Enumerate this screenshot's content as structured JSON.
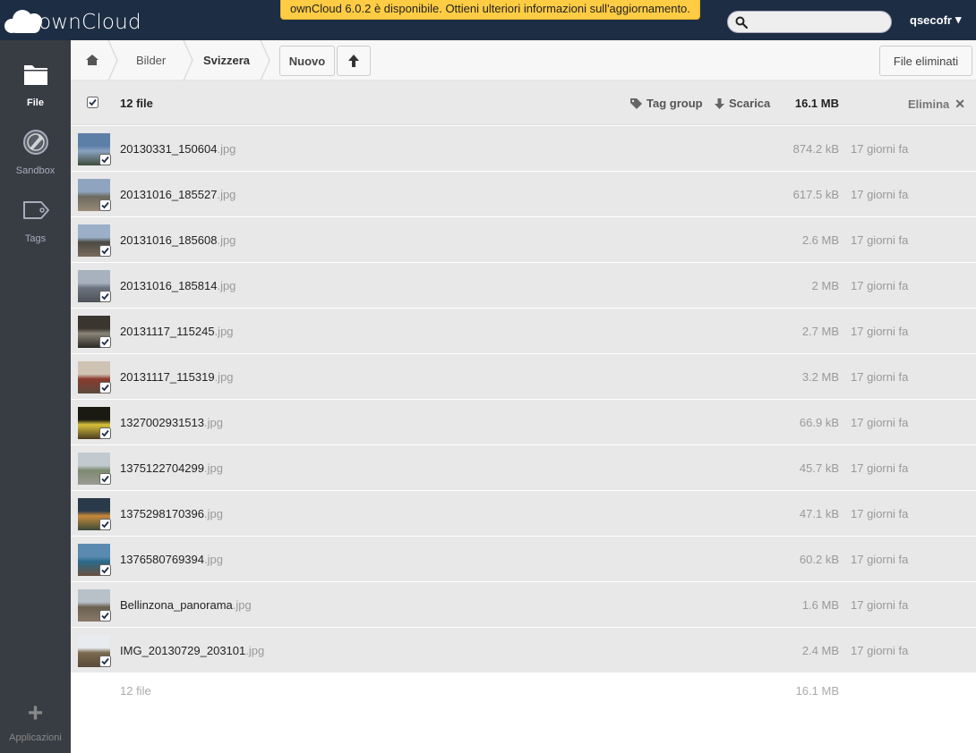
{
  "header": {
    "logo_text": "ownCloud",
    "update_notice": "ownCloud 6.0.2 è disponibile. Ottieni ulteriori informazioni sull'aggiornamento.",
    "search_placeholder": "",
    "user": "qsecofr",
    "user_caret": "▾"
  },
  "navigation": {
    "items": [
      {
        "label": "File",
        "icon": "folder-icon",
        "active": true
      },
      {
        "label": "Sandbox",
        "icon": "sandbox-icon",
        "active": false
      },
      {
        "label": "Tags",
        "icon": "tag-icon",
        "active": false
      }
    ],
    "apps_label": "Applicazioni",
    "apps_glyph": "+"
  },
  "controls": {
    "breadcrumb": [
      "Bilder",
      "Svizzera"
    ],
    "new_label": "Nuovo",
    "deleted_files_label": "File eliminati"
  },
  "table": {
    "selected_count": "12 file",
    "tag_group_label": "Tag group",
    "download_label": "Scarica",
    "total_size": "16.1 MB",
    "delete_label": "Elimina",
    "delete_glyph": "✕",
    "rows": [
      {
        "name": "20130331_150604",
        "ext": ".jpg",
        "size": "874.2 kB",
        "date": "17 giorni fa",
        "thumb": [
          "#5c7fa8",
          "#8aa3c0",
          "#3d4a3a"
        ]
      },
      {
        "name": "20131016_185527",
        "ext": ".jpg",
        "size": "617.5 kB",
        "date": "17 giorni fa",
        "thumb": [
          "#8fa4bf",
          "#6b6a5e",
          "#9a8a78"
        ]
      },
      {
        "name": "20131016_185608",
        "ext": ".jpg",
        "size": "2.6 MB",
        "date": "17 giorni fa",
        "thumb": [
          "#9bb0c8",
          "#4c4a44",
          "#7a6c5c"
        ]
      },
      {
        "name": "20131016_185814",
        "ext": ".jpg",
        "size": "2 MB",
        "date": "17 giorni fa",
        "thumb": [
          "#a7b2be",
          "#6c7480",
          "#4e5358"
        ]
      },
      {
        "name": "20131117_115245",
        "ext": ".jpg",
        "size": "2.7 MB",
        "date": "17 giorni fa",
        "thumb": [
          "#3b3530",
          "#8a8578",
          "#2a2622"
        ]
      },
      {
        "name": "20131117_115319",
        "ext": ".jpg",
        "size": "3.2 MB",
        "date": "17 giorni fa",
        "thumb": [
          "#cfc4b4",
          "#8a3b2e",
          "#5a4a3c"
        ]
      },
      {
        "name": "1327002931513",
        "ext": ".jpg",
        "size": "66.9 kB",
        "date": "17 giorni fa",
        "thumb": [
          "#1a1a12",
          "#d8c23a",
          "#4a3a20"
        ]
      },
      {
        "name": "1375122704299",
        "ext": ".jpg",
        "size": "45.7 kB",
        "date": "17 giorni fa",
        "thumb": [
          "#c2cad0",
          "#7c8a70",
          "#9a9a94"
        ]
      },
      {
        "name": "1375298170396",
        "ext": ".jpg",
        "size": "47.1 kB",
        "date": "17 giorni fa",
        "thumb": [
          "#2a3a4a",
          "#c88a3a",
          "#3a4a3a"
        ]
      },
      {
        "name": "1376580769394",
        "ext": ".jpg",
        "size": "60.2 kB",
        "date": "17 giorni fa",
        "thumb": [
          "#5a8ab0",
          "#2a6a8a",
          "#6a5040"
        ]
      },
      {
        "name": "Bellinzona_panorama",
        "ext": ".jpg",
        "size": "1.6 MB",
        "date": "17 giorni fa",
        "thumb": [
          "#b8c0c8",
          "#6a6050",
          "#8a7a68"
        ]
      },
      {
        "name": "IMG_20130729_203101",
        "ext": ".jpg",
        "size": "2.4 MB",
        "date": "17 giorni fa",
        "thumb": [
          "#e8ecf0",
          "#7a6a50",
          "#5a4a38"
        ]
      }
    ],
    "summary_count": "12 file",
    "summary_size": "16.1 MB"
  }
}
